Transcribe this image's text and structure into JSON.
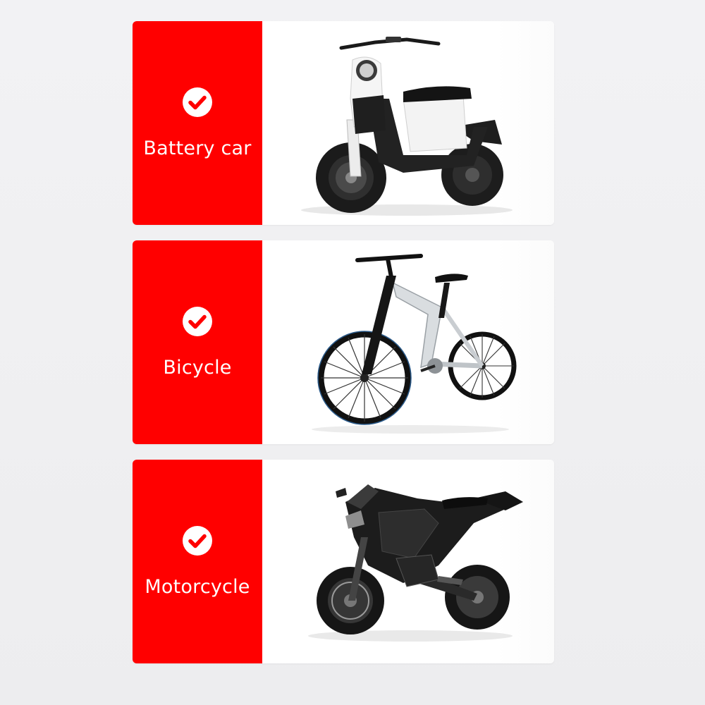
{
  "cards": [
    {
      "label": "Battery car",
      "check_icon": "check-circle-icon",
      "image": "electric-scooter-image"
    },
    {
      "label": "Bicycle",
      "check_icon": "check-circle-icon",
      "image": "bicycle-image"
    },
    {
      "label": "Motorcycle",
      "check_icon": "check-circle-icon",
      "image": "motorcycle-image"
    }
  ],
  "colors": {
    "accent": "#ff0000",
    "card_background": "#ffffff",
    "page_background": "#f0f0f2"
  }
}
